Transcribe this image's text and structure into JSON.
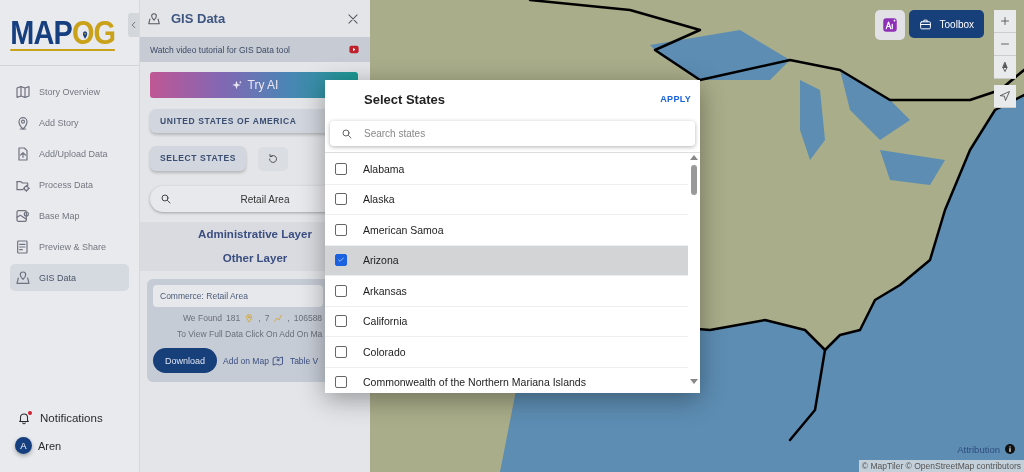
{
  "logo": {
    "part_1": "MAP",
    "part_2": "OG"
  },
  "sidebar": {
    "items": [
      {
        "label": "Story Overview",
        "selected": false
      },
      {
        "label": "Add Story",
        "selected": false
      },
      {
        "label": "Add/Upload Data",
        "selected": false
      },
      {
        "label": "Process Data",
        "selected": false
      },
      {
        "label": "Base Map",
        "selected": false
      },
      {
        "label": "Preview & Share",
        "selected": false
      },
      {
        "label": "GIS Data",
        "selected": true
      }
    ]
  },
  "notifications": {
    "label": "Notifications",
    "unread": true
  },
  "user": {
    "initial": "A",
    "name": "Aren"
  },
  "panel": {
    "title": "GIS Data",
    "tutorial": "Watch video tutorial for GIS Data tool",
    "try_ai": "Try AI",
    "country": "UNITED STATES OF AMERICA",
    "select_states": "SELECT STATES",
    "search": {
      "value": "Retail Area"
    },
    "layers": [
      "Administrative Layer",
      "Other Layer"
    ],
    "result": {
      "title": "Commerce: Retail Area",
      "found_label": "We Found",
      "counts": [
        {
          "value": "181",
          "suffix": ","
        },
        {
          "value": "7",
          "suffix": ","
        },
        {
          "value": "106588"
        }
      ],
      "hint": "To View Full Data Click On Add On Ma",
      "download": "Download",
      "add_on_map": "Add on Map",
      "table_view": "Table V"
    }
  },
  "map": {
    "toolbox": "Toolbox",
    "attribution": "Attribution",
    "copyright": "© MapTiler © OpenStreetMap contributors"
  },
  "modal": {
    "title": "Select States",
    "apply": "APPLY",
    "search": {
      "placeholder": "Search states"
    },
    "states": [
      {
        "name": "Alabama",
        "checked": false,
        "selected": false
      },
      {
        "name": "Alaska",
        "checked": false,
        "selected": false
      },
      {
        "name": "American Samoa",
        "checked": false,
        "selected": false
      },
      {
        "name": "Arizona",
        "checked": true,
        "selected": true
      },
      {
        "name": "Arkansas",
        "checked": false,
        "selected": false
      },
      {
        "name": "California",
        "checked": false,
        "selected": false
      },
      {
        "name": "Colorado",
        "checked": false,
        "selected": false
      },
      {
        "name": "Commonwealth of the Northern Mariana Islands",
        "checked": false,
        "selected": false
      }
    ]
  }
}
